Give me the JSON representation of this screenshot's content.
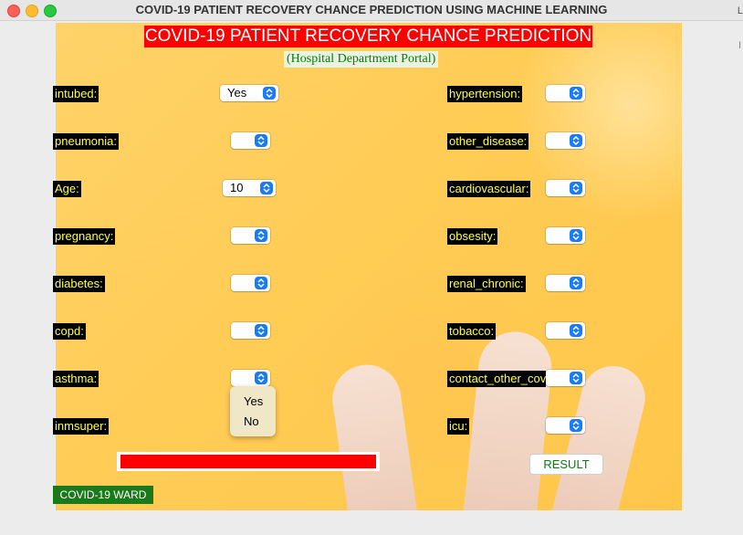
{
  "window": {
    "title": "COVID-19 PATIENT RECOVERY CHANCE PREDICTION USING MACHINE LEARNING",
    "edge_letter": "L",
    "edge_glyph": "I"
  },
  "app": {
    "title": "COVID-19 PATIENT RECOVERY CHANCE PREDICTION",
    "subtitle": "(Hospital Department Portal)",
    "ward_label": "COVID-19 WARD",
    "result_label": "RESULT",
    "progress_fraction": 1.0
  },
  "fields_left": [
    {
      "label": "intubed:",
      "value": "Yes"
    },
    {
      "label": "pneumonia:",
      "value": ""
    },
    {
      "label": "Age:",
      "value": "10"
    },
    {
      "label": "pregnancy:",
      "value": ""
    },
    {
      "label": "diabetes:",
      "value": ""
    },
    {
      "label": "copd:",
      "value": ""
    },
    {
      "label": "asthma:",
      "value": ""
    },
    {
      "label": "inmsuper:",
      "value": ""
    }
  ],
  "fields_right": [
    {
      "label": "hypertension:",
      "value": ""
    },
    {
      "label": "other_disease:",
      "value": ""
    },
    {
      "label": "cardiovascular:",
      "value": ""
    },
    {
      "label": "obsesity:",
      "value": ""
    },
    {
      "label": "renal_chronic:",
      "value": ""
    },
    {
      "label": "tobacco:",
      "value": ""
    },
    {
      "label": "contact_other_covid:",
      "value": ""
    },
    {
      "label": "icu:",
      "value": ""
    }
  ],
  "dropdown_open": {
    "options": [
      "Yes",
      "No"
    ]
  },
  "colors": {
    "title_bg": "#ff0000",
    "label_bg": "#000000",
    "label_text": "#ffff4a",
    "accent": "#1a7cf4",
    "ward_bg": "#1a7a1a"
  }
}
